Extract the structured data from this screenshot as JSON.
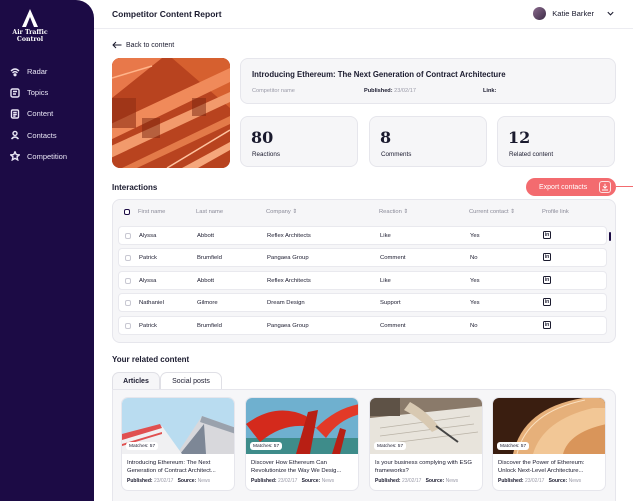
{
  "app": {
    "logo_text_line1": "Air Traffic",
    "logo_text_line2": "Control"
  },
  "sidebar": {
    "items": [
      {
        "label": "Radar",
        "icon": "radar-icon"
      },
      {
        "label": "Topics",
        "icon": "topics-icon"
      },
      {
        "label": "Content",
        "icon": "content-icon"
      },
      {
        "label": "Contacts",
        "icon": "contacts-icon"
      },
      {
        "label": "Competition",
        "icon": "star-icon"
      }
    ]
  },
  "header": {
    "title": "Competitor Content Report",
    "user_name": "Katie Barker"
  },
  "back": {
    "label": "Back to content"
  },
  "content": {
    "title": "Introducing Ethereum: The Next Generation of  Contract Architecture",
    "competitor_label": "Competitor name",
    "published_label": "Published:",
    "published_value": "23/02/17",
    "link_label": "Link:"
  },
  "stats": [
    {
      "value": "80",
      "label": "Reactions"
    },
    {
      "value": "8",
      "label": "Comments"
    },
    {
      "value": "12",
      "label": "Related content"
    }
  ],
  "interactions": {
    "title": "Interactions",
    "export_label": "Export contacts",
    "columns": [
      "First name",
      "Last name",
      "Company",
      "Reaction",
      "Current contact",
      "Profile link"
    ],
    "sort_suffix": "⇕",
    "rows": [
      {
        "first": "Alyssa",
        "last": "Abbott",
        "company": "Reflex Architects",
        "reaction": "Like",
        "contact": "Yes"
      },
      {
        "first": "Patrick",
        "last": "Brumfield",
        "company": "Pangaea Group",
        "reaction": "Comment",
        "contact": "No"
      },
      {
        "first": "Alyssa",
        "last": "Abbott",
        "company": "Reflex Architects",
        "reaction": "Like",
        "contact": "Yes"
      },
      {
        "first": "Nathaniel",
        "last": "Gilmore",
        "company": "Dream Design",
        "reaction": "Support",
        "contact": "Yes"
      },
      {
        "first": "Patrick",
        "last": "Brumfield",
        "company": "Pangaea Group",
        "reaction": "Comment",
        "contact": "No"
      }
    ],
    "linkedin_glyph": "in"
  },
  "related": {
    "title": "Your related content",
    "tabs": [
      "Articles",
      "Social posts"
    ],
    "active_tab": "Articles",
    "published_label": "Published:",
    "source_label": "Source:",
    "cards": [
      {
        "matches": "Matches: 57",
        "title": "Introducing Ethereum: The Next Generation of  Contract Architect...",
        "published": "23/02/17",
        "source": "News"
      },
      {
        "matches": "Matches: 57",
        "title": "Discover How Ethereum Can Revolutionize the Way We Desig...",
        "published": "23/02/17",
        "source": "News"
      },
      {
        "matches": "Matches: 57",
        "title": "Is your business complying with ESG frameworks?",
        "published": "23/02/17",
        "source": "News"
      },
      {
        "matches": "Matches: 57",
        "title": "Discover the Power of Ethereum: Unlock Next-Level Architecture...",
        "published": "23/02/17",
        "source": "News"
      }
    ]
  },
  "colors": {
    "sidebar": "#1c0b45",
    "accent": "#f36b6f",
    "panel": "#f6f6f8"
  }
}
